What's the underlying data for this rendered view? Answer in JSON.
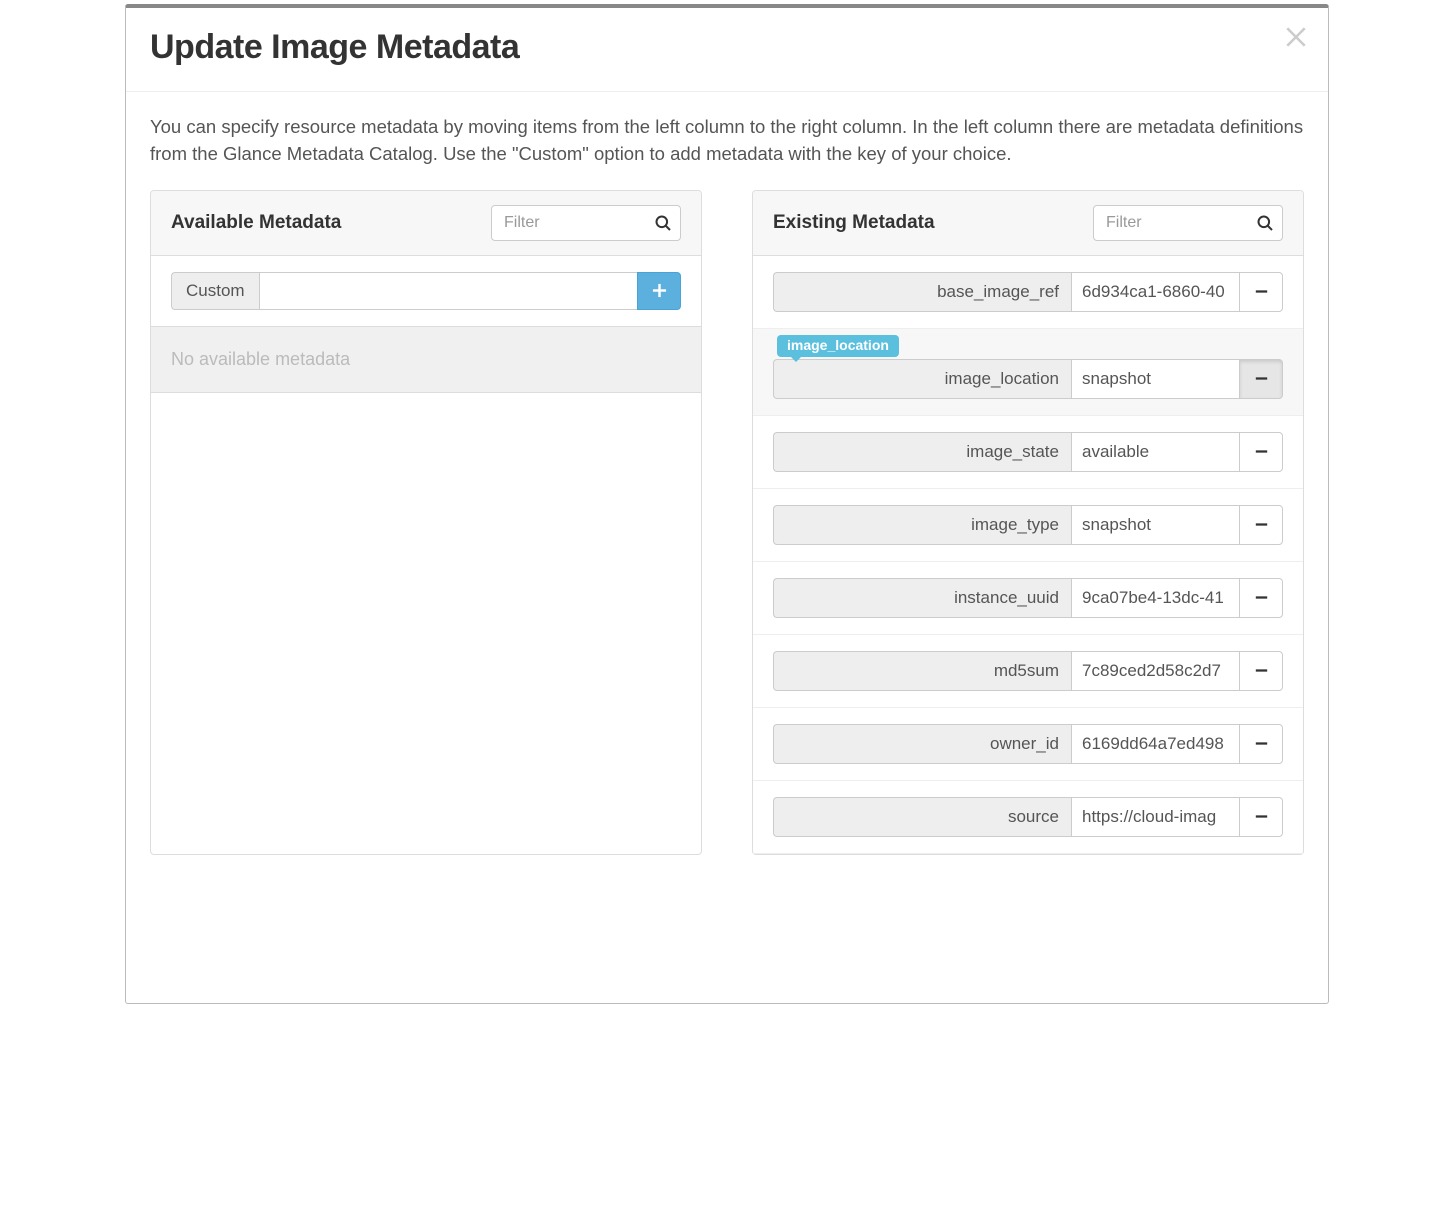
{
  "modal": {
    "title": "Update Image Metadata",
    "description": "You can specify resource metadata by moving items from the left column to the right column. In the left column there are metadata definitions from the Glance Metadata Catalog. Use the \"Custom\" option to add metadata with the key of your choice."
  },
  "available": {
    "heading": "Available Metadata",
    "filter_placeholder": "Filter",
    "filter_value": "",
    "custom_label": "Custom",
    "custom_value": "",
    "empty_text": "No available metadata"
  },
  "existing": {
    "heading": "Existing Metadata",
    "filter_placeholder": "Filter",
    "filter_value": "",
    "items": [
      {
        "key": "base_image_ref",
        "value": "6d934ca1-6860-40",
        "highlight": false
      },
      {
        "key": "image_location",
        "value": "snapshot",
        "highlight": true,
        "tooltip": "image_location"
      },
      {
        "key": "image_state",
        "value": "available",
        "highlight": false
      },
      {
        "key": "image_type",
        "value": "snapshot",
        "highlight": false
      },
      {
        "key": "instance_uuid",
        "value": "9ca07be4-13dc-41",
        "highlight": false
      },
      {
        "key": "md5sum",
        "value": "7c89ced2d58c2d7",
        "highlight": false
      },
      {
        "key": "owner_id",
        "value": "6169dd64a7ed498",
        "highlight": false
      },
      {
        "key": "source",
        "value": "https://cloud-imag",
        "highlight": false
      }
    ]
  }
}
